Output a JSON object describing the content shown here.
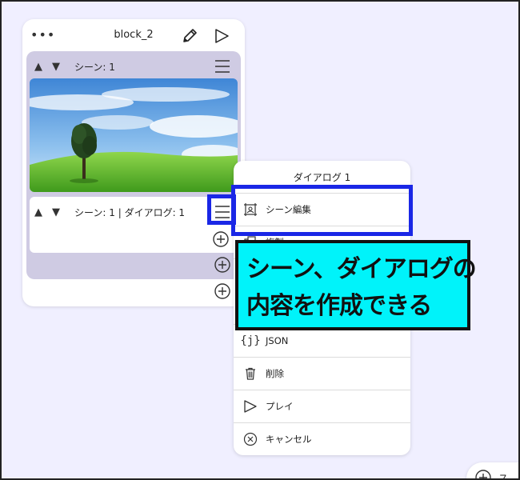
{
  "block": {
    "title": "block_2",
    "scene_label": "シーン: 1",
    "dialog_label": "シーン: 1 | ダイアログ: 1"
  },
  "menu": {
    "title": "ダイアログ 1",
    "items": [
      {
        "label": "シーン編集",
        "icon": "scene-edit-icon"
      },
      {
        "label": "複製",
        "icon": "duplicate-icon"
      },
      {
        "label": "",
        "icon": ""
      },
      {
        "label": "JSON",
        "icon": "json-icon"
      },
      {
        "label": "削除",
        "icon": "trash-icon"
      },
      {
        "label": "プレイ",
        "icon": "play-icon"
      },
      {
        "label": "キャンセル",
        "icon": "cancel-icon"
      }
    ]
  },
  "callout": {
    "line1": "シーン、ダイアログの",
    "line2": "内容を作成できる"
  },
  "corner_button": {
    "label": "ス"
  },
  "colors": {
    "background": "#f0efff",
    "scene_panel": "#cfcbe3",
    "highlight": "#1a27e6",
    "callout": "#00f3fa"
  }
}
